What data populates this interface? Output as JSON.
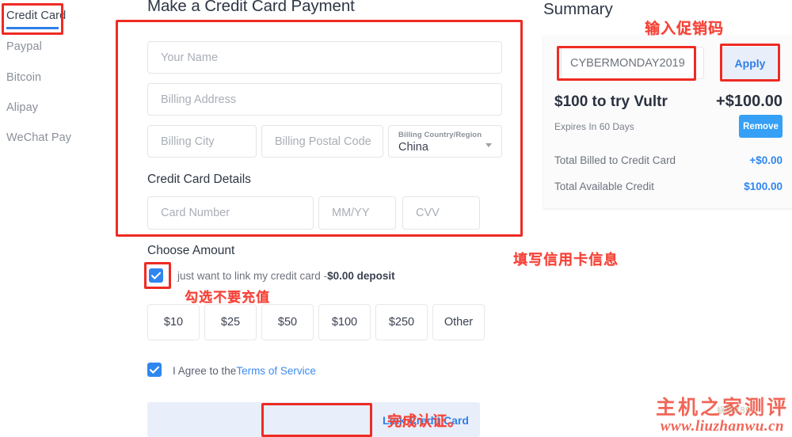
{
  "sidebar": {
    "items": [
      {
        "label": "Credit Card",
        "active": true
      },
      {
        "label": "Paypal",
        "active": false
      },
      {
        "label": "Bitcoin",
        "active": false
      },
      {
        "label": "Alipay",
        "active": false
      },
      {
        "label": "WeChat Pay",
        "active": false
      }
    ]
  },
  "form": {
    "title": "Make a Credit Card Payment",
    "name_placeholder": "Your Name",
    "address_placeholder": "Billing Address",
    "city_placeholder": "Billing City",
    "postal_placeholder": "Billing Postal Code",
    "country_label": "Billing Country/Region",
    "country_value": "China",
    "card_details_heading": "Credit Card Details",
    "card_number_placeholder": "Card Number",
    "expiry_placeholder": "MM/YY",
    "cvv_placeholder": "CVV",
    "choose_amount_heading": "Choose Amount",
    "link_card_text_prefix": "just want to link my credit card -",
    "link_card_text_bold": "$0.00 deposit",
    "amounts": [
      "$10",
      "$25",
      "$50",
      "$100",
      "$250",
      "Other"
    ],
    "tos_text": "I Agree to the",
    "tos_link": "Terms of Service",
    "submit_label": "Link Credit Card"
  },
  "summary": {
    "title": "Summary",
    "promo_value": "CYBERMONDAY2019",
    "apply_label": "Apply",
    "credit_name": "$100 to try Vultr",
    "credit_amount": "+$100.00",
    "expires": "Expires In 60 Days",
    "remove_label": "Remove",
    "rows": [
      {
        "label": "Total Billed to Credit Card",
        "value": "+$0.00"
      },
      {
        "label": "Total Available Credit",
        "value": "$100.00"
      }
    ]
  },
  "annotations": {
    "promo": "输入促销码",
    "card_info": "填写信用卡信息",
    "no_recharge": "勾选不要充值",
    "complete": "完成认证。"
  },
  "watermark": {
    "brand": "主机之家测评",
    "url": "www.liuzhanwu.cn",
    "ghost": "蜗牛789"
  },
  "colors": {
    "accent_blue": "#2f7fe8",
    "annotation_red": "#ee2b24",
    "remove_blue": "#35a0f5",
    "footer_bg": "#e8eefa"
  }
}
